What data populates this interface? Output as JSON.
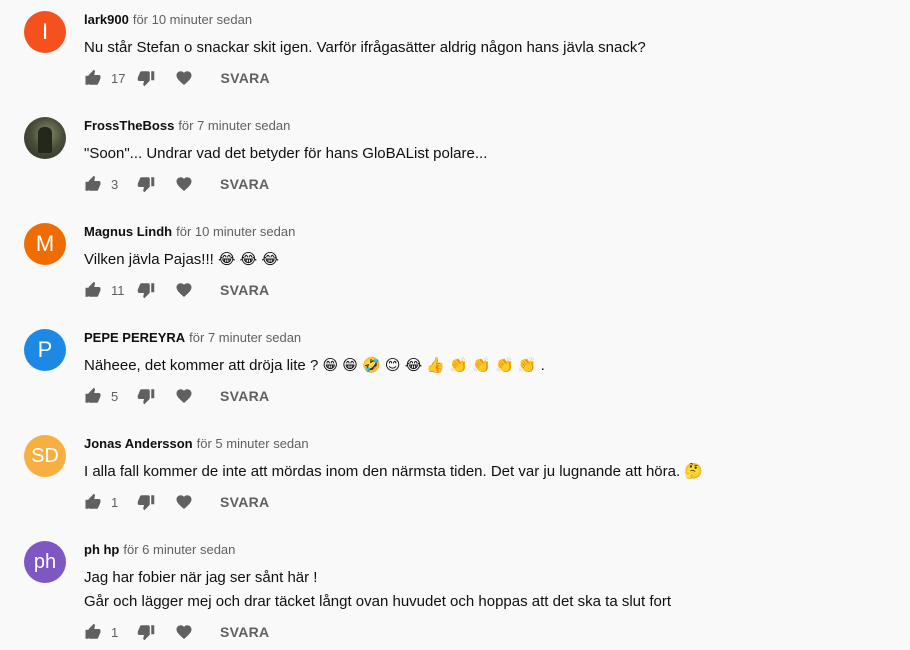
{
  "reply_label": "SVARA",
  "comments": [
    {
      "author": "lark900",
      "time": "för 10 minuter sedan",
      "avatar_letter": "I",
      "avatar_color": "#f4511e",
      "lines": [
        "Nu står Stefan o snackar skit igen. Varför ifrågasätter aldrig någon hans jävla snack?"
      ],
      "likes": "17"
    },
    {
      "author": "FrossTheBoss",
      "time": "för 7 minuter sedan",
      "avatar_letter": "",
      "avatar_color": "#4a4f3a",
      "lines": [
        "\"Soon\"... Undrar vad det betyder för hans GloBAList polare..."
      ],
      "likes": "3"
    },
    {
      "author": "Magnus Lindh",
      "time": "för 10 minuter sedan",
      "avatar_letter": "M",
      "avatar_color": "#ef6c00",
      "lines": [
        "Vilken jävla Pajas!!! 😂 😂 😂"
      ],
      "likes": "11"
    },
    {
      "author": "PEPE PEREYRA",
      "time": "för 7 minuter sedan",
      "avatar_letter": "P",
      "avatar_color": "#1e88e5",
      "lines": [
        "Näheee, det kommer att dröja lite ? 😁 😁 🤣 😊 😂 👍 👏 👏 👏 👏 ."
      ],
      "likes": "5"
    },
    {
      "author": "Jonas Andersson",
      "time": "för 5 minuter sedan",
      "avatar_letter": "SD",
      "avatar_color": "#f6b042",
      "lines": [
        "I alla fall kommer de inte att mördas inom den närmsta tiden. Det var ju lugnande att höra. 🤔"
      ],
      "likes": "1"
    },
    {
      "author": "ph hp",
      "time": "för 6 minuter sedan",
      "avatar_letter": "ph",
      "avatar_color": "#7e57c2",
      "lines": [
        "Jag har fobier när jag ser sånt här !",
        "Går och lägger mej och drar täcket långt ovan huvudet och hoppas att det ska ta slut fort"
      ],
      "likes": "1"
    }
  ]
}
